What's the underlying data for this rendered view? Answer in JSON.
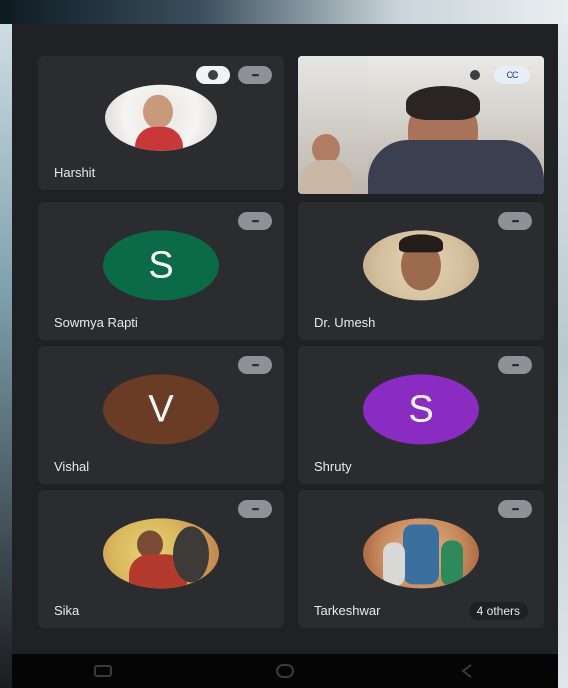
{
  "participants": [
    {
      "name": "Harshit",
      "avatar_type": "photo",
      "colors": [
        "#f3f3f1",
        "#c23a38"
      ]
    },
    {
      "name": "",
      "avatar_type": "video"
    },
    {
      "name": "Sowmya Rapti",
      "avatar_type": "initial",
      "initial": "S",
      "color": "#0b6b47"
    },
    {
      "name": "Dr. Umesh",
      "avatar_type": "photo",
      "colors": [
        "#d9c7a8",
        "#6b4b33"
      ]
    },
    {
      "name": "Vishal",
      "avatar_type": "initial",
      "initial": "V",
      "color": "#6a3b25"
    },
    {
      "name": "Shruty",
      "avatar_type": "initial",
      "initial": "S",
      "color": "#8a2bc2"
    },
    {
      "name": "Sika",
      "avatar_type": "photo",
      "colors": [
        "#e8d078",
        "#b43a2e"
      ]
    },
    {
      "name": "Tarkeshwar",
      "avatar_type": "photo",
      "colors": [
        "#cfa06a",
        "#3b6f9e"
      ],
      "extra": "4 others"
    }
  ],
  "icons": {
    "mic_muted": "mic-off-icon",
    "pin": "pin-icon",
    "cc": "cc-icon",
    "nav_back": "back-icon",
    "nav_home": "home-icon",
    "nav_recents": "recents-icon"
  },
  "colors": {
    "background": "#202124",
    "tile": "#2b2c30",
    "text": "#e8eaed"
  }
}
